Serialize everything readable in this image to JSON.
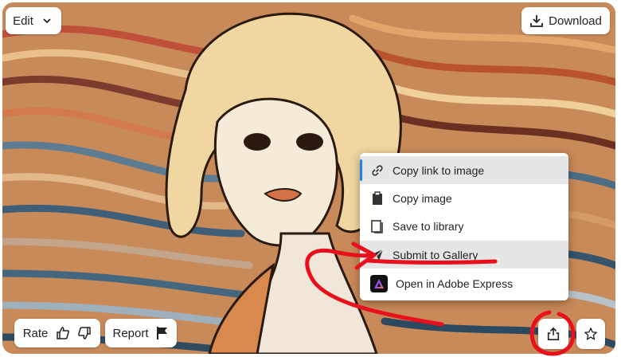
{
  "toolbar": {
    "edit_label": "Edit",
    "download_label": "Download"
  },
  "context_menu": {
    "items": [
      {
        "label": "Copy link to image",
        "icon": "link-icon"
      },
      {
        "label": "Copy image",
        "icon": "clipboard-icon"
      },
      {
        "label": "Save to library",
        "icon": "library-icon"
      },
      {
        "label": "Submit to Gallery",
        "icon": "send-icon"
      },
      {
        "label": "Open in Adobe Express",
        "icon": "adobe-express-icon"
      }
    ]
  },
  "footer": {
    "rate_label": "Rate",
    "report_label": "Report"
  },
  "colors": {
    "accent": "#2680eb",
    "annotation": "#e8101c",
    "menu_highlight": "#e6e6e6"
  }
}
